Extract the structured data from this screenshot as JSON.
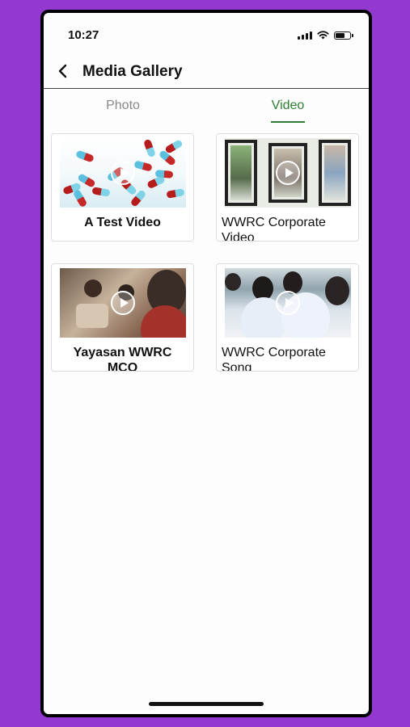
{
  "status_bar": {
    "time": "10:27"
  },
  "nav": {
    "title": "Media Gallery"
  },
  "tabs": [
    {
      "label": "Photo",
      "active": false
    },
    {
      "label": "Video",
      "active": true
    }
  ],
  "videos": [
    {
      "title": "A Test Video"
    },
    {
      "title": "WWRC Corporate Video"
    },
    {
      "title": "Yayasan WWRC MCO"
    },
    {
      "title": "WWRC Corporate Song"
    }
  ],
  "colors": {
    "accent": "#2e7d32",
    "background": "#9339cf"
  }
}
